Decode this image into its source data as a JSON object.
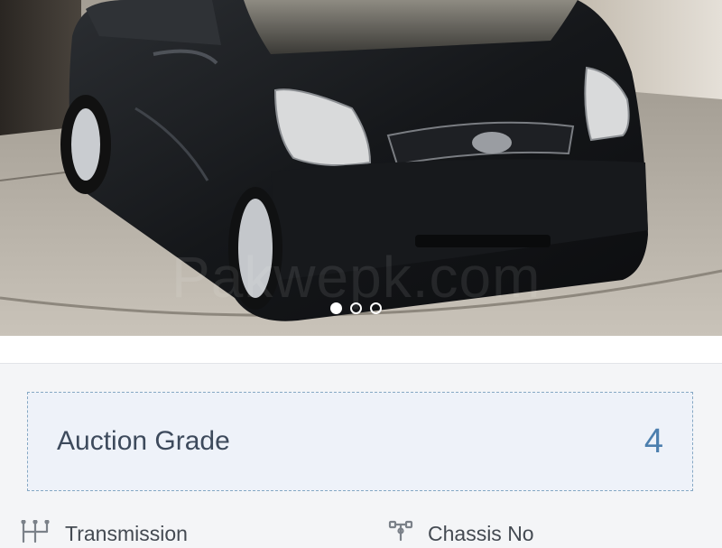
{
  "gallery": {
    "watermark": "Pakwepk.com",
    "slides": [
      {
        "active": true
      },
      {
        "active": false
      },
      {
        "active": false
      }
    ]
  },
  "auction": {
    "label": "Auction Grade",
    "value": "4"
  },
  "specs": {
    "transmission": {
      "label": "Transmission",
      "icon": "gearshift-icon"
    },
    "chassis": {
      "label": "Chassis No",
      "icon": "chassis-icon"
    }
  },
  "colors": {
    "grade_box_bg": "#eef2f9",
    "grade_box_border": "#86a8c4",
    "grade_value": "#4c7fae",
    "label_text": "#3d4a5c"
  }
}
